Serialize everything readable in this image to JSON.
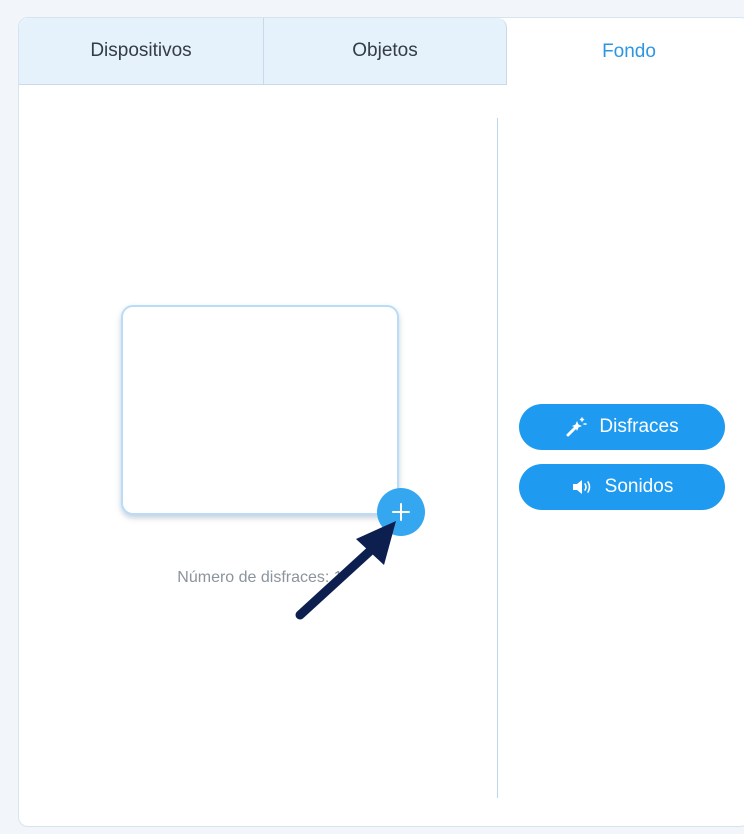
{
  "tabs": [
    {
      "label": "Dispositivos",
      "active": false
    },
    {
      "label": "Objetos",
      "active": false
    },
    {
      "label": "Fondo",
      "active": true
    }
  ],
  "stage": {
    "costume_count_label": "Número de disfraces: 1",
    "add_button_icon": "plus-icon"
  },
  "side_buttons": {
    "costumes_label": "Disfraces",
    "costumes_icon": "magic-wand-icon",
    "sounds_label": "Sonidos",
    "sounds_icon": "speaker-icon"
  },
  "colors": {
    "accent": "#1e9bf0",
    "active_tab_text": "#2d96e3",
    "annotation_arrow": "#0d1f4f"
  }
}
